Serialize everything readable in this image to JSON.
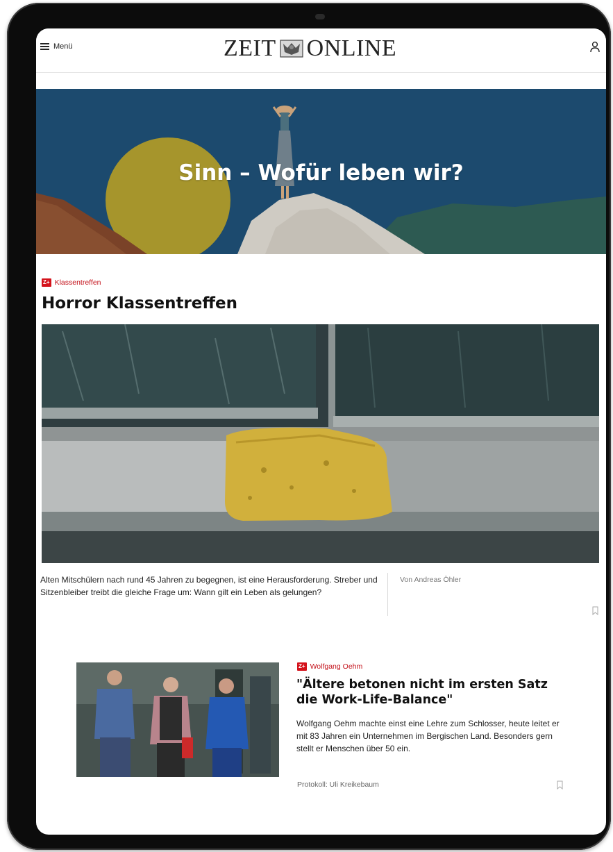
{
  "header": {
    "menu_label": "Menü",
    "logo_left": "ZEIT",
    "logo_right": "ONLINE"
  },
  "banner": {
    "title": "Sinn – Wofür leben wir?"
  },
  "main_article": {
    "badge": "Z+",
    "kicker": "Klassentreffen",
    "title": "Horror Klassentreffen",
    "teaser": "Alten Mitschülern nach rund 45 Jahren zu begegnen, ist eine Herausforderung. Streber und Sitzenbleiber treibt die gleiche Frage um: Wann gilt ein Leben als gelungen?",
    "author": "Von Andreas Öhler"
  },
  "second_article": {
    "badge": "Z+",
    "kicker": "Wolfgang Oehm",
    "title": "\"Ältere betonen nicht im ersten Satz die Work-Life-Balance\"",
    "teaser": "Wolfgang Oehm machte einst eine Lehre zum Schlosser, heute leitet er mit 83 Jahren ein Unternehmen im Bergischen Land. Besonders gern stellt er Menschen über 50 ein.",
    "author": "Protokoll: Uli Kreikebaum"
  },
  "icons": {
    "menu": "hamburger-icon",
    "user": "user-icon",
    "bookmark": "bookmark-icon",
    "emblem": "eagle-emblem-icon"
  },
  "colors": {
    "zplus_red": "#d4121b",
    "banner_blue": "#1c4a6e",
    "tablet_frame": "#0c0c0c"
  }
}
